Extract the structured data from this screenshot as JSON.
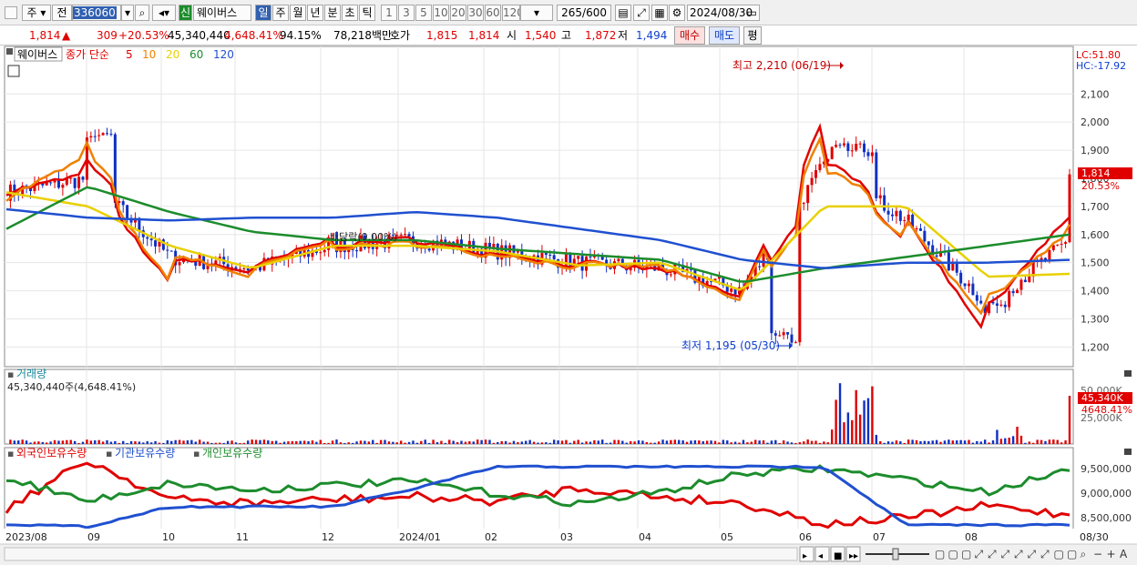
{
  "toolbar": {
    "period_select": "주",
    "compare_select": "전",
    "stock_code": "336060",
    "stock_name": "웨이버스",
    "credit_badge": "신",
    "periods": [
      "일",
      "주",
      "월",
      "년",
      "분",
      "초",
      "틱"
    ],
    "intervals": [
      "1",
      "3",
      "5",
      "10",
      "20",
      "30",
      "60",
      "120"
    ],
    "count_value": "265",
    "count_max": "/600",
    "date": "2024/08/30"
  },
  "quote": {
    "price": "1,814",
    "change": "309",
    "change_rate": "+20.53%",
    "volume": "45,340,440",
    "volume_rate": "4,648.41%",
    "turnover_rate": "94.15%",
    "amount": "78,218백만",
    "bid_ask_label": "호가",
    "ask": "1,815",
    "bid": "1,814",
    "open_label": "시",
    "open": "1,540",
    "high_label": "고",
    "high": "1,872",
    "low_label": "저",
    "low": "1,494",
    "buy_button": "매수",
    "sell_button": "매도",
    "avg_button": "평"
  },
  "price_panel": {
    "stock_tag": "웨이버스",
    "legend_title": "종가 단순",
    "ma_labels": [
      "5",
      "10",
      "20",
      "60",
      "120"
    ],
    "ma_colors": [
      "#e00000",
      "#f08000",
      "#e8d000",
      "#1c8c2c",
      "#2050d0"
    ],
    "lc_label": "LC:51.80",
    "hc_label": "HC:-17.92",
    "high_annotation": "최고 2,210 (06/19)",
    "low_annotation": "최저 1,195 (05/30)",
    "dividend_annotation": "배당락(0.00%)",
    "current_price": "1,814",
    "current_rate": "20.53%"
  },
  "volume_panel": {
    "title": "거래량",
    "value_text": "45,340,440주(4,648.41%)",
    "current": "45,340K",
    "current_rate": "4648.41%"
  },
  "holding_panel": {
    "legend": [
      "외국인보유수량",
      "기관보유수량",
      "개인보유수량"
    ],
    "legend_colors": [
      "#e00000",
      "#2050d0",
      "#1c8c2c"
    ]
  },
  "x_labels": [
    "2023/08",
    "09",
    "10",
    "11",
    "12",
    "2024/01",
    "02",
    "03",
    "04",
    "05",
    "06",
    "07",
    "08",
    "08/30"
  ],
  "chart_data": {
    "type": "line",
    "title": "",
    "price_axis_ticks": [
      1200,
      1300,
      1400,
      1500,
      1600,
      1700,
      1800,
      1900,
      2000,
      2100
    ],
    "volume_axis_ticks": [
      "50,000K",
      "25,000K"
    ],
    "holding_axis_ticks": [
      "9,500,000",
      "9,000,000",
      "8,500,000"
    ],
    "price_range": [
      1130,
      2240
    ],
    "high_point": {
      "date": "06/19",
      "value": 2210
    },
    "low_point": {
      "date": "05/30",
      "value": 1195
    },
    "series": [
      {
        "name": "5",
        "approx_close_by_month": [
          1750,
          1800,
          1520,
          1480,
          1560,
          1580,
          1540,
          1500,
          1480,
          1400,
          1850,
          1650,
          1350,
          1580
        ]
      },
      {
        "name": "10",
        "approx_close_by_month": [
          1720,
          1850,
          1540,
          1470,
          1550,
          1560,
          1530,
          1490,
          1490,
          1390,
          1800,
          1640,
          1400,
          1540
        ]
      },
      {
        "name": "20",
        "approx_close_by_month": [
          1750,
          1700,
          1560,
          1480,
          1560,
          1560,
          1540,
          1490,
          1500,
          1400,
          1700,
          1700,
          1450,
          1460
        ]
      },
      {
        "name": "60",
        "approx_close_by_month": [
          1620,
          1770,
          1680,
          1610,
          1580,
          1580,
          1550,
          1530,
          1510,
          1430,
          1480,
          1520,
          1560,
          1600
        ]
      },
      {
        "name": "120",
        "approx_close_by_month": [
          1690,
          1660,
          1650,
          1660,
          1660,
          1680,
          1660,
          1620,
          1580,
          1510,
          1480,
          1500,
          1500,
          1510
        ]
      }
    ]
  }
}
